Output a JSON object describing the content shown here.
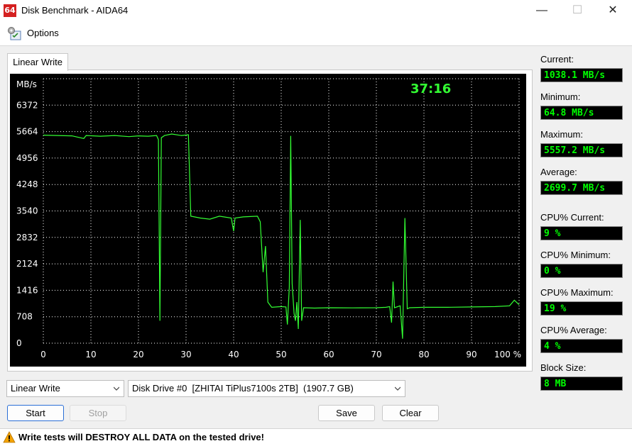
{
  "window": {
    "app_icon_text": "64",
    "title": "Disk Benchmark - AIDA64",
    "minimize_glyph": "—",
    "maximize_glyph": "☐",
    "close_glyph": "✕"
  },
  "menu": {
    "options_label": "Options",
    "options_icon": "options-gear-icon"
  },
  "tab": {
    "label": "Linear Write"
  },
  "chart_data": {
    "type": "line",
    "title": "",
    "ylabel": "MB/s",
    "timer": "37:16",
    "y_ticks": [
      "6372",
      "5664",
      "4956",
      "4248",
      "3540",
      "2832",
      "2124",
      "1416",
      "708",
      "0"
    ],
    "x_ticks": [
      "0",
      "10",
      "20",
      "30",
      "40",
      "50",
      "60",
      "70",
      "80",
      "90",
      "100 %"
    ],
    "xlim": [
      0,
      100
    ],
    "ylim": [
      0,
      7080
    ],
    "grid": true,
    "line_color": "#33ff33",
    "series": [
      {
        "values": [
          [
            0,
            5570
          ],
          [
            3,
            5560
          ],
          [
            6,
            5550
          ],
          [
            8.5,
            5480
          ],
          [
            9,
            5560
          ],
          [
            12,
            5540
          ],
          [
            15,
            5560
          ],
          [
            18,
            5530
          ],
          [
            20,
            5550
          ],
          [
            22,
            5540
          ],
          [
            23.8,
            5560
          ],
          [
            24.2,
            5450
          ],
          [
            24.5,
            600
          ],
          [
            24.8,
            5500
          ],
          [
            25.5,
            5560
          ],
          [
            27,
            5600
          ],
          [
            29,
            5560
          ],
          [
            30.5,
            5580
          ],
          [
            31,
            3400
          ],
          [
            33,
            3350
          ],
          [
            35,
            3320
          ],
          [
            37,
            3400
          ],
          [
            39.5,
            3350
          ],
          [
            40,
            3000
          ],
          [
            40.3,
            3350
          ],
          [
            42,
            3380
          ],
          [
            45,
            3400
          ],
          [
            45.6,
            3250
          ],
          [
            46.2,
            1900
          ],
          [
            46.7,
            2600
          ],
          [
            47.2,
            1100
          ],
          [
            48,
            960
          ],
          [
            50,
            980
          ],
          [
            51,
            970
          ],
          [
            51.3,
            500
          ],
          [
            51.7,
            1500
          ],
          [
            52,
            5550
          ],
          [
            52.3,
            1600
          ],
          [
            52.7,
            800
          ],
          [
            53,
            600
          ],
          [
            53.3,
            1100
          ],
          [
            53.6,
            380
          ],
          [
            54,
            3300
          ],
          [
            54.3,
            600
          ],
          [
            54.7,
            950
          ],
          [
            57,
            940
          ],
          [
            60,
            950
          ],
          [
            65,
            945
          ],
          [
            70,
            950
          ],
          [
            72,
            960
          ],
          [
            72.8,
            980
          ],
          [
            73.2,
            550
          ],
          [
            73.5,
            1650
          ],
          [
            73.8,
            950
          ],
          [
            75,
            1000
          ],
          [
            75.5,
            120
          ],
          [
            76,
            3350
          ],
          [
            76.5,
            920
          ],
          [
            77,
            950
          ],
          [
            80,
            960
          ],
          [
            85,
            960
          ],
          [
            90,
            970
          ],
          [
            95,
            980
          ],
          [
            98,
            1000
          ],
          [
            99,
            1150
          ],
          [
            100,
            1030
          ]
        ]
      }
    ]
  },
  "stats": {
    "current_label": "Current:",
    "current_value": "1038.1 MB/s",
    "minimum_label": "Minimum:",
    "minimum_value": "64.8 MB/s",
    "maximum_label": "Maximum:",
    "maximum_value": "5557.2 MB/s",
    "average_label": "Average:",
    "average_value": "2699.7 MB/s",
    "cpu_current_label": "CPU% Current:",
    "cpu_current_value": "9 %",
    "cpu_minimum_label": "CPU% Minimum:",
    "cpu_minimum_value": "0 %",
    "cpu_maximum_label": "CPU% Maximum:",
    "cpu_maximum_value": "19 %",
    "cpu_average_label": "CPU% Average:",
    "cpu_average_value": "4 %",
    "block_size_label": "Block Size:",
    "block_size_value": "8 MB"
  },
  "controls": {
    "test_select_value": "Linear Write",
    "drive_select_value": "Disk Drive #0  [ZHITAI TiPlus7100s 2TB]  (1907.7 GB)",
    "start_label": "Start",
    "stop_label": "Stop",
    "save_label": "Save",
    "clear_label": "Clear"
  },
  "status": {
    "warning_text": "Write tests will DESTROY ALL DATA on the tested drive!",
    "warning_icon": "warning-icon"
  },
  "colors": {
    "chart_bg": "#000000",
    "grid": "#ffffff",
    "line": "#33ff33",
    "value_text": "#00ff00",
    "warning": "#f5a300"
  }
}
